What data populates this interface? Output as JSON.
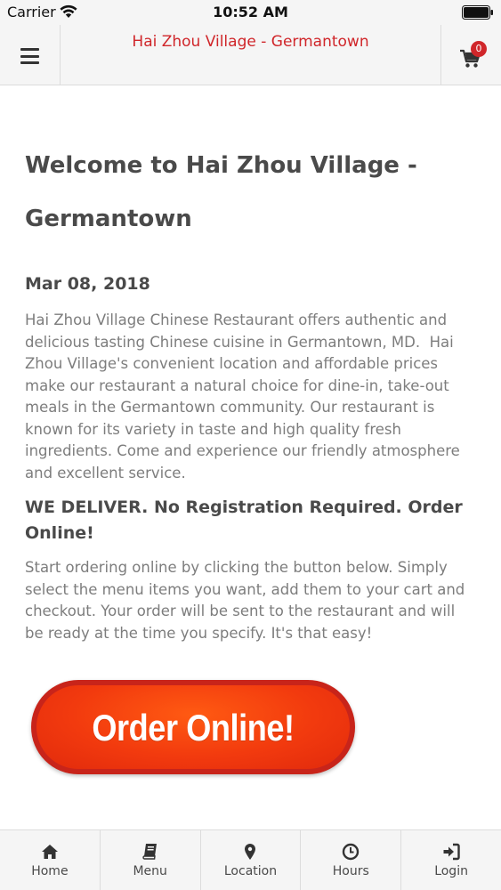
{
  "status_bar": {
    "carrier": "Carrier",
    "time": "10:52 AM"
  },
  "header": {
    "title": "Hai Zhou Village - Germantown",
    "cart_count": "0",
    "accent_color": "#d0262a"
  },
  "content": {
    "title": "Welcome to Hai Zhou Village - Germantown",
    "date": "Mar 08, 2018",
    "intro": "Hai Zhou Village Chinese Restaurant offers authentic and delicious tasting Chinese cuisine in Germantown, MD.  Hai Zhou Village's convenient location and affordable prices make our restaurant a natural choice for dine-in, take-out meals in the Germantown community. Our restaurant is known for its variety in taste and high quality fresh ingredients. Come and experience our friendly atmosphere and excellent service.",
    "delivery_heading": "WE DELIVER. No Registration Required. Order Online!",
    "ordering_text": "Start ordering online by clicking the button below. Simply select the menu items you want, add them to your cart and checkout. Your order will be sent to the restaurant and will be ready at the time you specify. It's that easy!",
    "order_button_label": "Order Online!"
  },
  "tabs": [
    {
      "label": "Home",
      "icon": "home-icon"
    },
    {
      "label": "Menu",
      "icon": "book-icon"
    },
    {
      "label": "Location",
      "icon": "map-pin-icon"
    },
    {
      "label": "Hours",
      "icon": "clock-icon"
    },
    {
      "label": "Login",
      "icon": "login-icon"
    }
  ]
}
